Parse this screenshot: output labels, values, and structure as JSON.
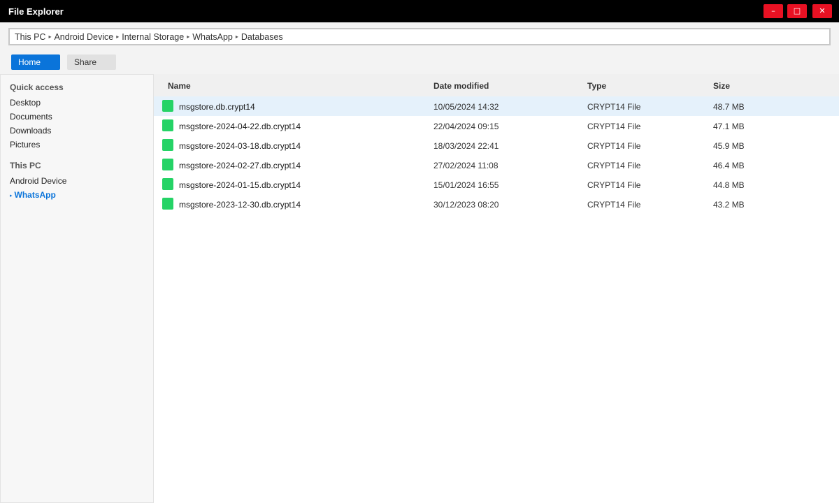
{
  "window": {
    "title": "File Explorer",
    "minimize": "–",
    "maximize": "□",
    "close": "✕"
  },
  "address": {
    "breadcrumbs": [
      "This PC",
      "Android Device",
      "Internal Storage",
      "WhatsApp",
      "Databases"
    ],
    "separator": "▸"
  },
  "ribbon": {
    "home": "Home",
    "share": "Share"
  },
  "sidebar": {
    "quick_access_title": "Quick access",
    "quick_access_items": [
      "Desktop",
      "Documents",
      "Downloads",
      "Pictures"
    ],
    "this_pc_title": "This PC",
    "this_pc_items": [
      "Android Device",
      "WhatsApp"
    ],
    "active_caret": "▸"
  },
  "columns": {
    "name": "Name",
    "date": "Date modified",
    "type": "Type",
    "size": "Size"
  },
  "files": [
    {
      "name": "msgstore.db.crypt14",
      "date": "10/05/2024 14:32",
      "type": "CRYPT14 File",
      "size": "48.7 MB"
    },
    {
      "name": "msgstore-2024-04-22.db.crypt14",
      "date": "22/04/2024 09:15",
      "type": "CRYPT14 File",
      "size": "47.1 MB"
    },
    {
      "name": "msgstore-2024-03-18.db.crypt14",
      "date": "18/03/2024 22:41",
      "type": "CRYPT14 File",
      "size": "45.9 MB"
    },
    {
      "name": "msgstore-2024-02-27.db.crypt14",
      "date": "27/02/2024 11:08",
      "type": "CRYPT14 File",
      "size": "46.4 MB"
    },
    {
      "name": "msgstore-2024-01-15.db.crypt14",
      "date": "15/01/2024 16:55",
      "type": "CRYPT14 File",
      "size": "44.8 MB"
    },
    {
      "name": "msgstore-2023-12-30.db.crypt14",
      "date": "30/12/2023 08:20",
      "type": "CRYPT14 File",
      "size": "43.2 MB"
    }
  ],
  "colors": {
    "titlebar": "#000000",
    "window_buttons": "#e81123",
    "accent": "#0a74da",
    "file_icon": "#25d366",
    "selected_row": "#e5f1fb"
  },
  "icons": {
    "file": "whatsapp-db-file-icon"
  }
}
